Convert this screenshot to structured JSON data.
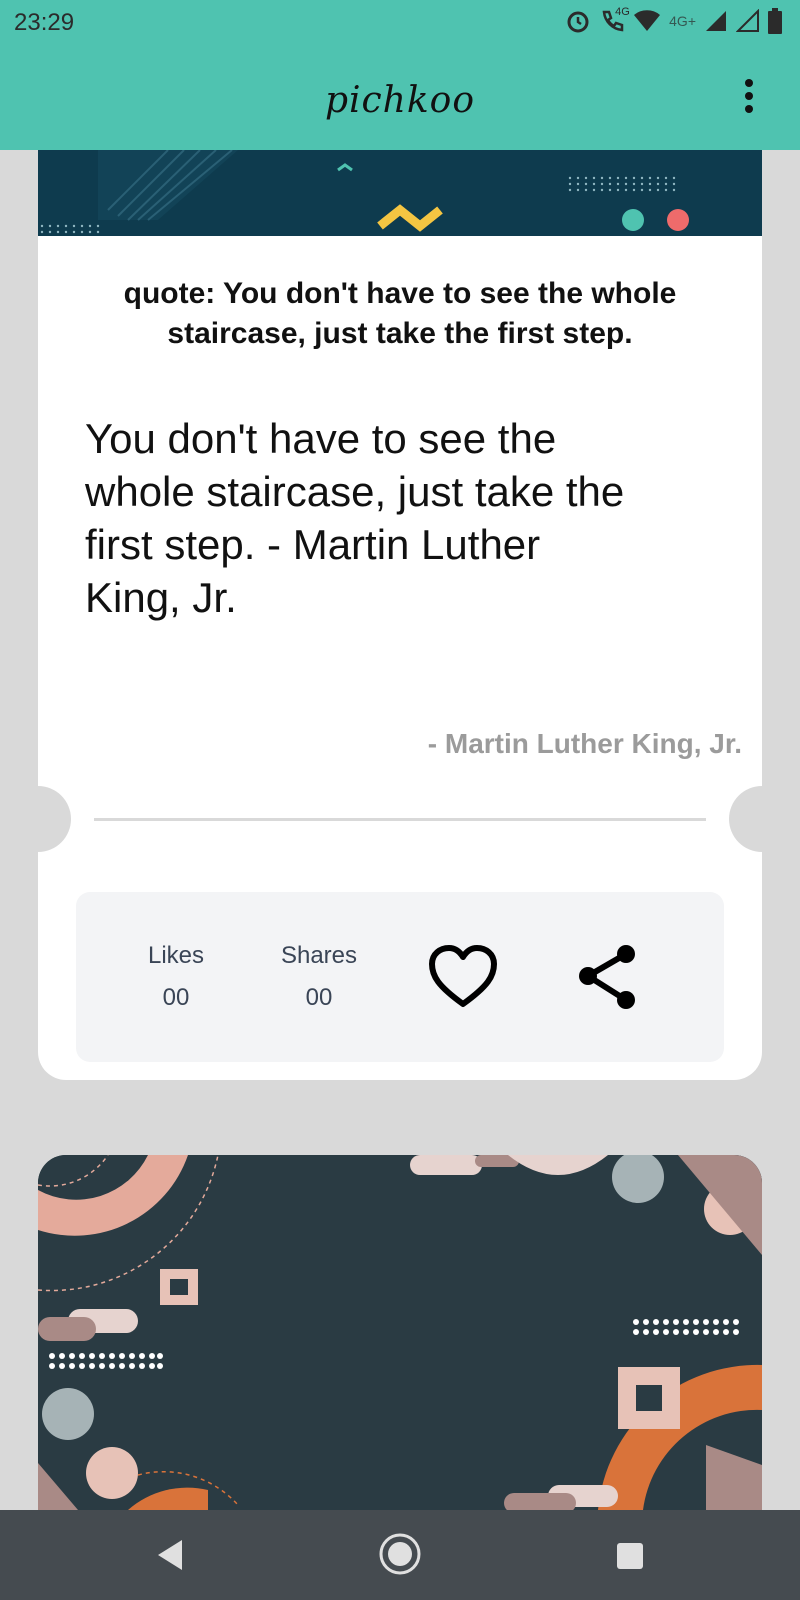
{
  "status_bar": {
    "time": "23:29",
    "network_label_1": "4G",
    "network_label_2": "4G+"
  },
  "app_bar": {
    "title": "pichkoo",
    "menu_icon": "more-vertical-icon"
  },
  "card": {
    "quote_title": "quote: You don't have to see the whole staircase, just take the first step.",
    "quote_body": "You don't have to see the whole staircase, just take the first step. - Martin Luther King, Jr.",
    "author": "- Martin Luther King, Jr.",
    "likes_label": "Likes",
    "likes_value": "00",
    "shares_label": "Shares",
    "shares_value": "00",
    "like_icon": "heart-icon",
    "share_icon": "share-icon"
  },
  "colors": {
    "accent": "#4fc3b0",
    "banner": "#0e3b4e",
    "card2_bg": "#2a3b43",
    "nav_bg": "#454b50"
  },
  "nav_bar": {
    "back_icon": "back-icon",
    "home_icon": "home-icon",
    "recents_icon": "recents-icon"
  }
}
